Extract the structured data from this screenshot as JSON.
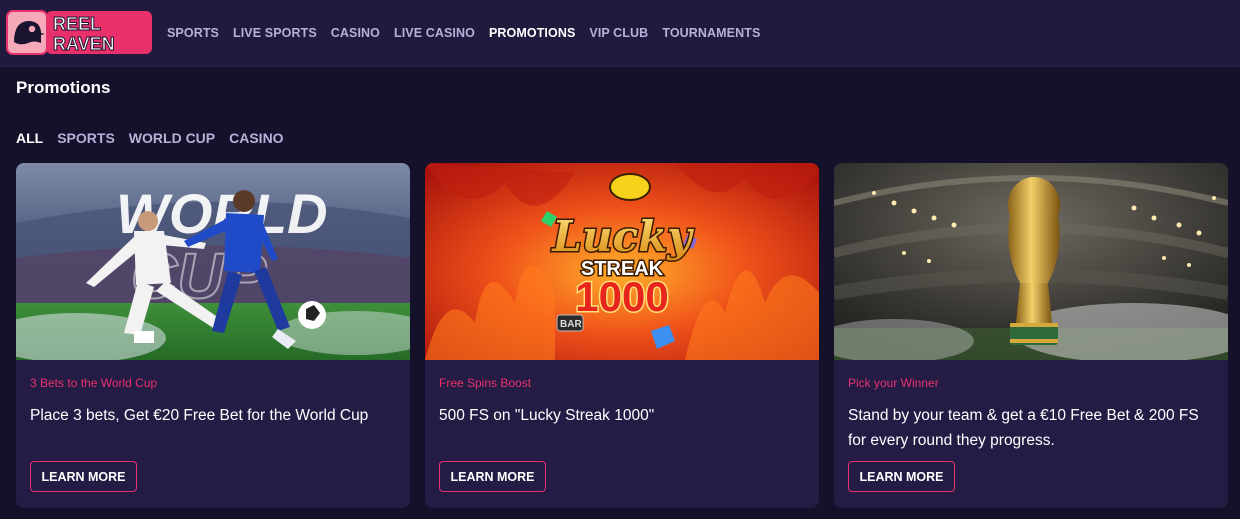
{
  "brand": {
    "logo_line1": "REEL",
    "logo_line2": "RAVEN"
  },
  "nav": {
    "items": [
      {
        "label": "SPORTS",
        "active": false
      },
      {
        "label": "LIVE SPORTS",
        "active": false
      },
      {
        "label": "CASINO",
        "active": false
      },
      {
        "label": "LIVE CASINO",
        "active": false
      },
      {
        "label": "PROMOTIONS",
        "active": true
      },
      {
        "label": "VIP CLUB",
        "active": false
      },
      {
        "label": "TOURNAMENTS",
        "active": false
      }
    ]
  },
  "page": {
    "title": "Promotions"
  },
  "filters": {
    "items": [
      {
        "label": "ALL",
        "active": true
      },
      {
        "label": "SPORTS",
        "active": false
      },
      {
        "label": "WORLD CUP",
        "active": false
      },
      {
        "label": "CASINO",
        "active": false
      }
    ]
  },
  "cards": [
    {
      "tag": "3 Bets to the World Cup",
      "title": "Place 3 bets, Get €20 Free Bet for the World Cup",
      "button": "LEARN MORE",
      "image_text": "WORLD"
    },
    {
      "tag": "Free Spins Boost",
      "title": "500 FS on \"Lucky Streak 1000\"",
      "button": "LEARN MORE",
      "image_text": [
        "Lucky",
        "STREAK",
        "1000",
        "BAR"
      ]
    },
    {
      "tag": "Pick your Winner",
      "title": "Stand by your team & get a €10 Free Bet & 200 FS for every round they progress.",
      "button": "LEARN MORE"
    }
  ],
  "colors": {
    "background": "#15112a",
    "topbar": "#211a3e",
    "card": "#241c45",
    "accent": "#e8316b",
    "nav_text": "#b7b0d9"
  }
}
